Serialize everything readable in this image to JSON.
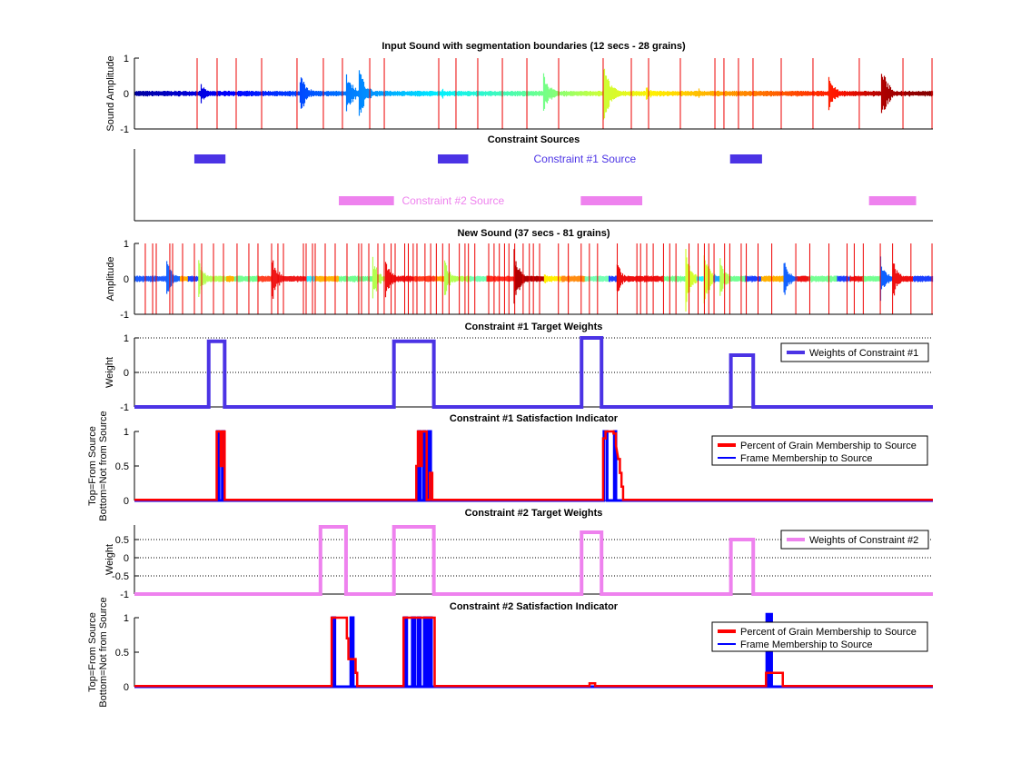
{
  "chart_data": [
    {
      "id": "input-sound",
      "type": "line",
      "title": "Input Sound with segmentation boundaries (12 secs - 28 grains)",
      "ylabel": "Sound Amplitude",
      "ylim": [
        -1,
        1
      ],
      "yticks": [
        "1",
        "0",
        "-1"
      ],
      "xlim": [
        0,
        1
      ],
      "boundaries": [
        0.0785,
        0.1035,
        0.1274,
        0.1593,
        0.2036,
        0.2366,
        0.2605,
        0.2947,
        0.3129,
        0.3811,
        0.4027,
        0.43,
        0.4608,
        0.4915,
        0.5313,
        0.587,
        0.6223,
        0.6439,
        0.6837,
        0.727,
        0.7383,
        0.7565,
        0.7747,
        0.81,
        0.8498,
        0.9078,
        0.9625,
        0.9989
      ],
      "bursts": [
        {
          "x": 0.083,
          "amp": 0.25
        },
        {
          "x": 0.207,
          "amp": 0.6
        },
        {
          "x": 0.264,
          "amp": 0.7
        },
        {
          "x": 0.281,
          "amp": 0.7
        },
        {
          "x": 0.384,
          "amp": 0.15
        },
        {
          "x": 0.511,
          "amp": 0.6
        },
        {
          "x": 0.587,
          "amp": 0.8
        },
        {
          "x": 0.589,
          "amp": 0.7
        },
        {
          "x": 0.64,
          "amp": 0.2
        },
        {
          "x": 0.706,
          "amp": 0.15
        },
        {
          "x": 0.869,
          "amp": 0.5
        },
        {
          "x": 0.935,
          "amp": 0.75
        }
      ]
    },
    {
      "id": "constraint-sources",
      "type": "bar",
      "title": "Constraint Sources",
      "series": [
        {
          "name": "Constraint #1 Source",
          "color": "#4b33e5",
          "label_x": 0.5,
          "intervals": [
            [
              0.075,
              0.114
            ],
            [
              0.38,
              0.418
            ],
            [
              0.746,
              0.786
            ]
          ]
        },
        {
          "name": "Constraint #2 Source",
          "color": "#ee82ee",
          "label_x": 0.335,
          "intervals": [
            [
              0.256,
              0.325
            ],
            [
              0.559,
              0.636
            ],
            [
              0.92,
              0.979
            ]
          ]
        }
      ]
    },
    {
      "id": "new-sound",
      "type": "line",
      "title": "New Sound (37 secs - 81 grains)",
      "ylabel": "Amplitude",
      "ylim": [
        -1,
        1
      ],
      "yticks": [
        "1",
        "0",
        "-1"
      ],
      "xlim": [
        0,
        1
      ],
      "boundaries": [
        0.0136,
        0.0228,
        0.0273,
        0.0443,
        0.0478,
        0.0603,
        0.0751,
        0.0842,
        0.099,
        0.1115,
        0.1285,
        0.1433,
        0.1547,
        0.1718,
        0.1797,
        0.1866,
        0.2116,
        0.215,
        0.223,
        0.2264,
        0.2389,
        0.2514,
        0.2662,
        0.2809,
        0.2844,
        0.2935,
        0.3049,
        0.3128,
        0.3215,
        0.3265,
        0.3385,
        0.343,
        0.3491,
        0.3538,
        0.3639,
        0.371,
        0.3781,
        0.386,
        0.394,
        0.4069,
        0.414,
        0.4183,
        0.4263,
        0.4437,
        0.4504,
        0.457,
        0.4635,
        0.469,
        0.4763,
        0.4868,
        0.4946,
        0.4996,
        0.5074,
        0.531,
        0.5434,
        0.5595,
        0.5698,
        0.58,
        0.6047,
        0.6293,
        0.6339,
        0.6416,
        0.6497,
        0.6626,
        0.6704,
        0.6782,
        0.6946,
        0.7059,
        0.7138,
        0.7193,
        0.7259,
        0.7391,
        0.7456,
        0.7599,
        0.7663,
        0.781,
        0.7982,
        0.8283,
        0.8458,
        0.8698,
        0.8925,
        0.9015,
        0.9128,
        0.9341,
        0.9495,
        0.9725,
        0.9989
      ],
      "segments": [
        {
          "x0": 0.0,
          "x1": 0.04,
          "c": "#1f5cff",
          "amp": 0.06
        },
        {
          "x0": 0.04,
          "x1": 0.057,
          "c": "#0f60ff",
          "amp": 0.55
        },
        {
          "x0": 0.057,
          "x1": 0.067,
          "c": "#ffb000",
          "amp": 0.05
        },
        {
          "x0": 0.067,
          "x1": 0.08,
          "c": "#1a40ff",
          "amp": 0.06
        },
        {
          "x0": 0.08,
          "x1": 0.115,
          "c": "#b4ff50",
          "amp": 0.6
        },
        {
          "x0": 0.115,
          "x1": 0.125,
          "c": "#ffb000",
          "amp": 0.05
        },
        {
          "x0": 0.125,
          "x1": 0.155,
          "c": "#70ff90",
          "amp": 0.06
        },
        {
          "x0": 0.155,
          "x1": 0.172,
          "c": "#ff3a1a",
          "amp": 0.06
        },
        {
          "x0": 0.172,
          "x1": 0.215,
          "c": "#ee1010",
          "amp": 0.7
        },
        {
          "x0": 0.215,
          "x1": 0.226,
          "c": "#30f0ff",
          "amp": 0.1
        },
        {
          "x0": 0.226,
          "x1": 0.256,
          "c": "#ffb000",
          "amp": 0.05
        },
        {
          "x0": 0.256,
          "x1": 0.298,
          "c": "#70ff90",
          "amp": 0.05
        },
        {
          "x0": 0.298,
          "x1": 0.314,
          "c": "#b4ff50",
          "amp": 0.6
        },
        {
          "x0": 0.314,
          "x1": 0.35,
          "c": "#ee1010",
          "amp": 0.6
        },
        {
          "x0": 0.35,
          "x1": 0.377,
          "c": "#ff3a1a",
          "amp": 0.05
        },
        {
          "x0": 0.377,
          "x1": 0.388,
          "c": "#ffa000",
          "amp": 0.05
        },
        {
          "x0": 0.388,
          "x1": 0.42,
          "c": "#b4ff50",
          "amp": 0.5
        },
        {
          "x0": 0.42,
          "x1": 0.441,
          "c": "#70ffb0",
          "amp": 0.05
        },
        {
          "x0": 0.441,
          "x1": 0.475,
          "c": "#ff2a1a",
          "amp": 0.05
        },
        {
          "x0": 0.475,
          "x1": 0.513,
          "c": "#b00000",
          "amp": 0.8
        },
        {
          "x0": 0.513,
          "x1": 0.534,
          "c": "#ffee00",
          "amp": 0.15
        },
        {
          "x0": 0.534,
          "x1": 0.564,
          "c": "#ff8c10",
          "amp": 0.05
        },
        {
          "x0": 0.564,
          "x1": 0.594,
          "c": "#70ffb0",
          "amp": 0.05
        },
        {
          "x0": 0.594,
          "x1": 0.604,
          "c": "#1a40ff",
          "amp": 0.06
        },
        {
          "x0": 0.604,
          "x1": 0.662,
          "c": "#ee1010",
          "amp": 0.45
        },
        {
          "x0": 0.662,
          "x1": 0.69,
          "c": "#70ff90",
          "amp": 0.06
        },
        {
          "x0": 0.69,
          "x1": 0.704,
          "c": "#d4ff30",
          "amp": 0.85
        },
        {
          "x0": 0.704,
          "x1": 0.713,
          "c": "#20f0ff",
          "amp": 0.1
        },
        {
          "x0": 0.713,
          "x1": 0.725,
          "c": "#d4ff30",
          "amp": 0.85
        },
        {
          "x0": 0.725,
          "x1": 0.733,
          "c": "#10a0ff",
          "amp": 0.15
        },
        {
          "x0": 0.733,
          "x1": 0.745,
          "c": "#b4ff50",
          "amp": 0.6
        },
        {
          "x0": 0.745,
          "x1": 0.765,
          "c": "#70ff90",
          "amp": 0.05
        },
        {
          "x0": 0.765,
          "x1": 0.785,
          "c": "#1a40ff",
          "amp": 0.06
        },
        {
          "x0": 0.785,
          "x1": 0.813,
          "c": "#ffb000",
          "amp": 0.05
        },
        {
          "x0": 0.813,
          "x1": 0.83,
          "c": "#0f60ff",
          "amp": 0.6
        },
        {
          "x0": 0.83,
          "x1": 0.845,
          "c": "#ee1010",
          "amp": 0.05
        },
        {
          "x0": 0.845,
          "x1": 0.88,
          "c": "#70ff90",
          "amp": 0.06
        },
        {
          "x0": 0.88,
          "x1": 0.896,
          "c": "#1a40ff",
          "amp": 0.06
        },
        {
          "x0": 0.896,
          "x1": 0.912,
          "c": "#ee1010",
          "amp": 0.05
        },
        {
          "x0": 0.912,
          "x1": 0.934,
          "c": "#70ff90",
          "amp": 0.06
        },
        {
          "x0": 0.934,
          "x1": 0.95,
          "c": "#0f60ff",
          "amp": 0.6
        },
        {
          "x0": 0.95,
          "x1": 0.975,
          "c": "#ee1010",
          "amp": 0.5
        },
        {
          "x0": 0.975,
          "x1": 1.0,
          "c": "#1a40ff",
          "amp": 0.06
        }
      ]
    },
    {
      "id": "c1-weights",
      "type": "line",
      "title": "Constraint #1 Target Weights",
      "ylabel": "Weight",
      "ylim": [
        -1,
        1
      ],
      "yticks": [
        "1",
        "0",
        "-1"
      ],
      "grid": true,
      "legend": {
        "position": "top-right",
        "entries": [
          {
            "name": "Weights of Constraint #1",
            "color": "#4b33e5"
          }
        ]
      },
      "pulses": [
        {
          "x0": 0.093,
          "x1": 0.113,
          "value": 0.9
        },
        {
          "x0": 0.325,
          "x1": 0.375,
          "value": 0.9
        },
        {
          "x0": 0.56,
          "x1": 0.585,
          "value": 1.0
        },
        {
          "x0": 0.747,
          "x1": 0.775,
          "value": 0.5
        }
      ],
      "baseline": -1,
      "color": "#4b33e5"
    },
    {
      "id": "c1-satisfaction",
      "type": "line",
      "title": "Constraint #1 Satisfaction Indicator",
      "ylabel": "Top=From Source\nBottom=Not from Source",
      "ylabel_lines": [
        "Top=From Source",
        "Bottom=Not from Source"
      ],
      "ylim": [
        0,
        1
      ],
      "yticks": [
        "1",
        "0.5",
        "0"
      ],
      "legend": {
        "position": "top-right",
        "entries": [
          {
            "name": "Percent of Grain Membership to Source",
            "color": "#ff0000"
          },
          {
            "name": "Frame Membership to Source",
            "color": "#0000ff"
          }
        ]
      },
      "red_steps": [
        [
          0.0,
          0.01
        ],
        [
          0.103,
          0.01
        ],
        [
          0.103,
          1
        ],
        [
          0.108,
          1
        ],
        [
          0.108,
          0.5
        ],
        [
          0.11,
          0.5
        ],
        [
          0.11,
          1
        ],
        [
          0.113,
          1
        ],
        [
          0.113,
          0.01
        ],
        [
          0.353,
          0.01
        ],
        [
          0.353,
          0.5
        ],
        [
          0.355,
          0.5
        ],
        [
          0.355,
          1
        ],
        [
          0.358,
          1
        ],
        [
          0.358,
          0.5
        ],
        [
          0.36,
          0.5
        ],
        [
          0.36,
          1
        ],
        [
          0.366,
          1
        ],
        [
          0.366,
          0.01
        ],
        [
          0.37,
          0.01
        ],
        [
          0.37,
          0.4
        ],
        [
          0.373,
          0.4
        ],
        [
          0.373,
          0.01
        ],
        [
          0.587,
          0.01
        ],
        [
          0.587,
          0.9
        ],
        [
          0.59,
          0.9
        ],
        [
          0.59,
          1
        ],
        [
          0.6,
          1
        ],
        [
          0.6,
          0.97
        ],
        [
          0.603,
          0.97
        ],
        [
          0.603,
          0.8
        ],
        [
          0.606,
          0.6
        ],
        [
          0.608,
          0.6
        ],
        [
          0.608,
          0.4
        ],
        [
          0.61,
          0.4
        ],
        [
          0.61,
          0.2
        ],
        [
          0.612,
          0.2
        ],
        [
          0.612,
          0.01
        ],
        [
          1.0,
          0.01
        ]
      ],
      "blue_steps": [
        [
          0.0,
          0.0
        ],
        [
          0.104,
          0.0
        ],
        [
          0.104,
          1
        ],
        [
          0.106,
          1
        ],
        [
          0.106,
          0.0
        ],
        [
          0.11,
          0.0
        ],
        [
          0.11,
          1
        ],
        [
          0.112,
          1
        ],
        [
          0.112,
          0.0
        ],
        [
          0.356,
          0.0
        ],
        [
          0.356,
          1
        ],
        [
          0.358,
          1
        ],
        [
          0.358,
          0.0
        ],
        [
          0.362,
          0.0
        ],
        [
          0.362,
          1
        ],
        [
          0.364,
          1
        ],
        [
          0.364,
          0.0
        ],
        [
          0.368,
          0.0
        ],
        [
          0.368,
          1
        ],
        [
          0.371,
          1
        ],
        [
          0.371,
          0.0
        ],
        [
          0.588,
          0.0
        ],
        [
          0.588,
          1
        ],
        [
          0.592,
          1
        ],
        [
          0.592,
          0.0
        ],
        [
          0.601,
          0.0
        ],
        [
          0.601,
          1
        ],
        [
          0.603,
          1
        ],
        [
          0.603,
          0.0
        ],
        [
          1.0,
          0.0
        ]
      ]
    },
    {
      "id": "c2-weights",
      "type": "line",
      "title": "Constraint #2 Target Weights",
      "ylabel": "Weight",
      "ylim": [
        -1,
        0.9
      ],
      "yticks": [
        "0.5",
        "0",
        "-0.5",
        "-1"
      ],
      "grid": true,
      "legend": {
        "position": "top-right",
        "entries": [
          {
            "name": "Weights of Constraint #2",
            "color": "#ee82ee"
          }
        ]
      },
      "pulses": [
        {
          "x0": 0.233,
          "x1": 0.265,
          "value": 0.85
        },
        {
          "x0": 0.325,
          "x1": 0.375,
          "value": 0.85
        },
        {
          "x0": 0.56,
          "x1": 0.585,
          "value": 0.7
        },
        {
          "x0": 0.747,
          "x1": 0.775,
          "value": 0.5
        }
      ],
      "baseline": -1,
      "color": "#ee82ee"
    },
    {
      "id": "c2-satisfaction",
      "type": "line",
      "title": "Constraint #2 Satisfaction Indicator",
      "ylabel_lines": [
        "Top=From Source",
        "Bottom=Not from Source"
      ],
      "ylim": [
        0,
        1
      ],
      "yticks": [
        "1",
        "0.5",
        "0"
      ],
      "legend": {
        "position": "top-right",
        "entries": [
          {
            "name": "Percent of Grain Membership to Source",
            "color": "#ff0000"
          },
          {
            "name": "Frame Membership to Source",
            "color": "#0000ff"
          }
        ]
      },
      "red_steps": [
        [
          0.0,
          0.01
        ],
        [
          0.247,
          0.01
        ],
        [
          0.247,
          1
        ],
        [
          0.266,
          1
        ],
        [
          0.266,
          0.7
        ],
        [
          0.268,
          0.7
        ],
        [
          0.268,
          0.4
        ],
        [
          0.277,
          0.4
        ],
        [
          0.277,
          0.2
        ],
        [
          0.279,
          0.2
        ],
        [
          0.279,
          0.01
        ],
        [
          0.337,
          0.01
        ],
        [
          0.337,
          1
        ],
        [
          0.376,
          1
        ],
        [
          0.376,
          0.01
        ],
        [
          0.57,
          0.01
        ],
        [
          0.57,
          0.05
        ],
        [
          0.577,
          0.05
        ],
        [
          0.577,
          0.01
        ],
        [
          0.791,
          0.01
        ],
        [
          0.791,
          0.2
        ],
        [
          0.812,
          0.2
        ],
        [
          0.812,
          0.01
        ],
        [
          1.0,
          0.01
        ]
      ],
      "blue_steps": [
        [
          0.0,
          0.0
        ],
        [
          0.248,
          0.0
        ],
        [
          0.248,
          1
        ],
        [
          0.251,
          1
        ],
        [
          0.251,
          0.0
        ],
        [
          0.271,
          0.0
        ],
        [
          0.271,
          1
        ],
        [
          0.274,
          1
        ],
        [
          0.274,
          0.0
        ],
        [
          0.338,
          0.0
        ],
        [
          0.338,
          1
        ],
        [
          0.341,
          1
        ],
        [
          0.341,
          0.0
        ],
        [
          0.348,
          0.0
        ],
        [
          0.348,
          1
        ],
        [
          0.351,
          1
        ],
        [
          0.351,
          0.0
        ],
        [
          0.355,
          0.0
        ],
        [
          0.355,
          1
        ],
        [
          0.358,
          1
        ],
        [
          0.358,
          0.0
        ],
        [
          0.363,
          0.0
        ],
        [
          0.363,
          1
        ],
        [
          0.366,
          1
        ],
        [
          0.366,
          0.0
        ],
        [
          0.369,
          0.0
        ],
        [
          0.369,
          1
        ],
        [
          0.372,
          1
        ],
        [
          0.372,
          0.0
        ],
        [
          0.792,
          0.0
        ],
        [
          0.792,
          1.05
        ],
        [
          0.794,
          1.05
        ],
        [
          0.794,
          0.0
        ],
        [
          0.796,
          0.0
        ],
        [
          0.796,
          1.05
        ],
        [
          0.798,
          1.05
        ],
        [
          0.798,
          0.0
        ],
        [
          1.0,
          0.0
        ]
      ]
    }
  ]
}
